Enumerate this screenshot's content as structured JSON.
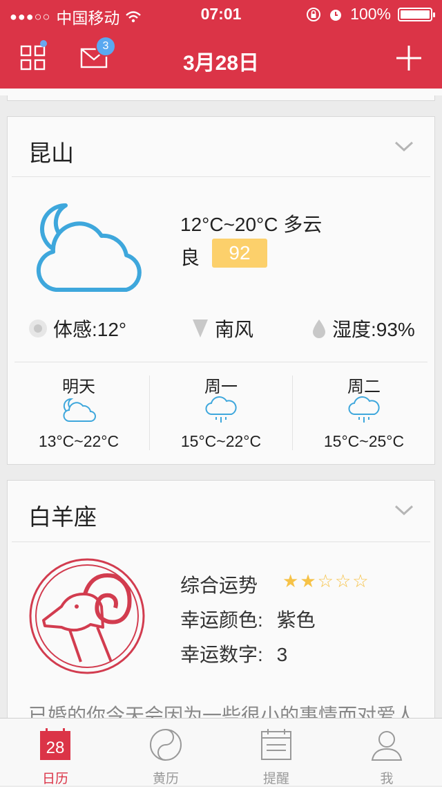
{
  "status": {
    "carrier": "中国移动",
    "time": "07:01",
    "battery": "100%",
    "signal_bars_filled": 3,
    "signal_bars_total": 5
  },
  "header": {
    "title": "3月28日",
    "mail_badge": "3"
  },
  "weather": {
    "city": "昆山",
    "temp_range": "12°C~20°C",
    "condition": "多云",
    "air_quality_label": "良",
    "aqi": "92",
    "feels_like": "体感:12°",
    "wind": "南风",
    "humidity": "湿度:93%",
    "forecast": [
      {
        "day": "明天",
        "temp": "13°C~22°C",
        "icon": "partly-cloudy-night-icon"
      },
      {
        "day": "周一",
        "temp": "15°C~22°C",
        "icon": "rain-cloud-icon"
      },
      {
        "day": "周二",
        "temp": "15°C~25°C",
        "icon": "rain-cloud-icon"
      }
    ]
  },
  "horoscope": {
    "sign": "白羊座",
    "overall_label": "综合运势",
    "overall_stars": 2,
    "overall_stars_max": 5,
    "lucky_color_label": "幸运颜色:",
    "lucky_color": "紫色",
    "lucky_number_label": "幸运数字:",
    "lucky_number": "3",
    "description": "已婚的你今天会因为一些很小的事情而对爱人产"
  },
  "tabbar": {
    "items": [
      {
        "label": "日历",
        "icon": "calendar-icon",
        "calendar_day": "28",
        "active": true
      },
      {
        "label": "黄历",
        "icon": "yin-yang-icon",
        "active": false
      },
      {
        "label": "提醒",
        "icon": "reminder-icon",
        "active": false
      },
      {
        "label": "我",
        "icon": "user-icon",
        "active": false
      }
    ]
  },
  "colors": {
    "brand": "#db3447",
    "aqi_badge": "#fcd06b",
    "weather_icon": "#3ea7dc",
    "star": "#f6c247"
  }
}
